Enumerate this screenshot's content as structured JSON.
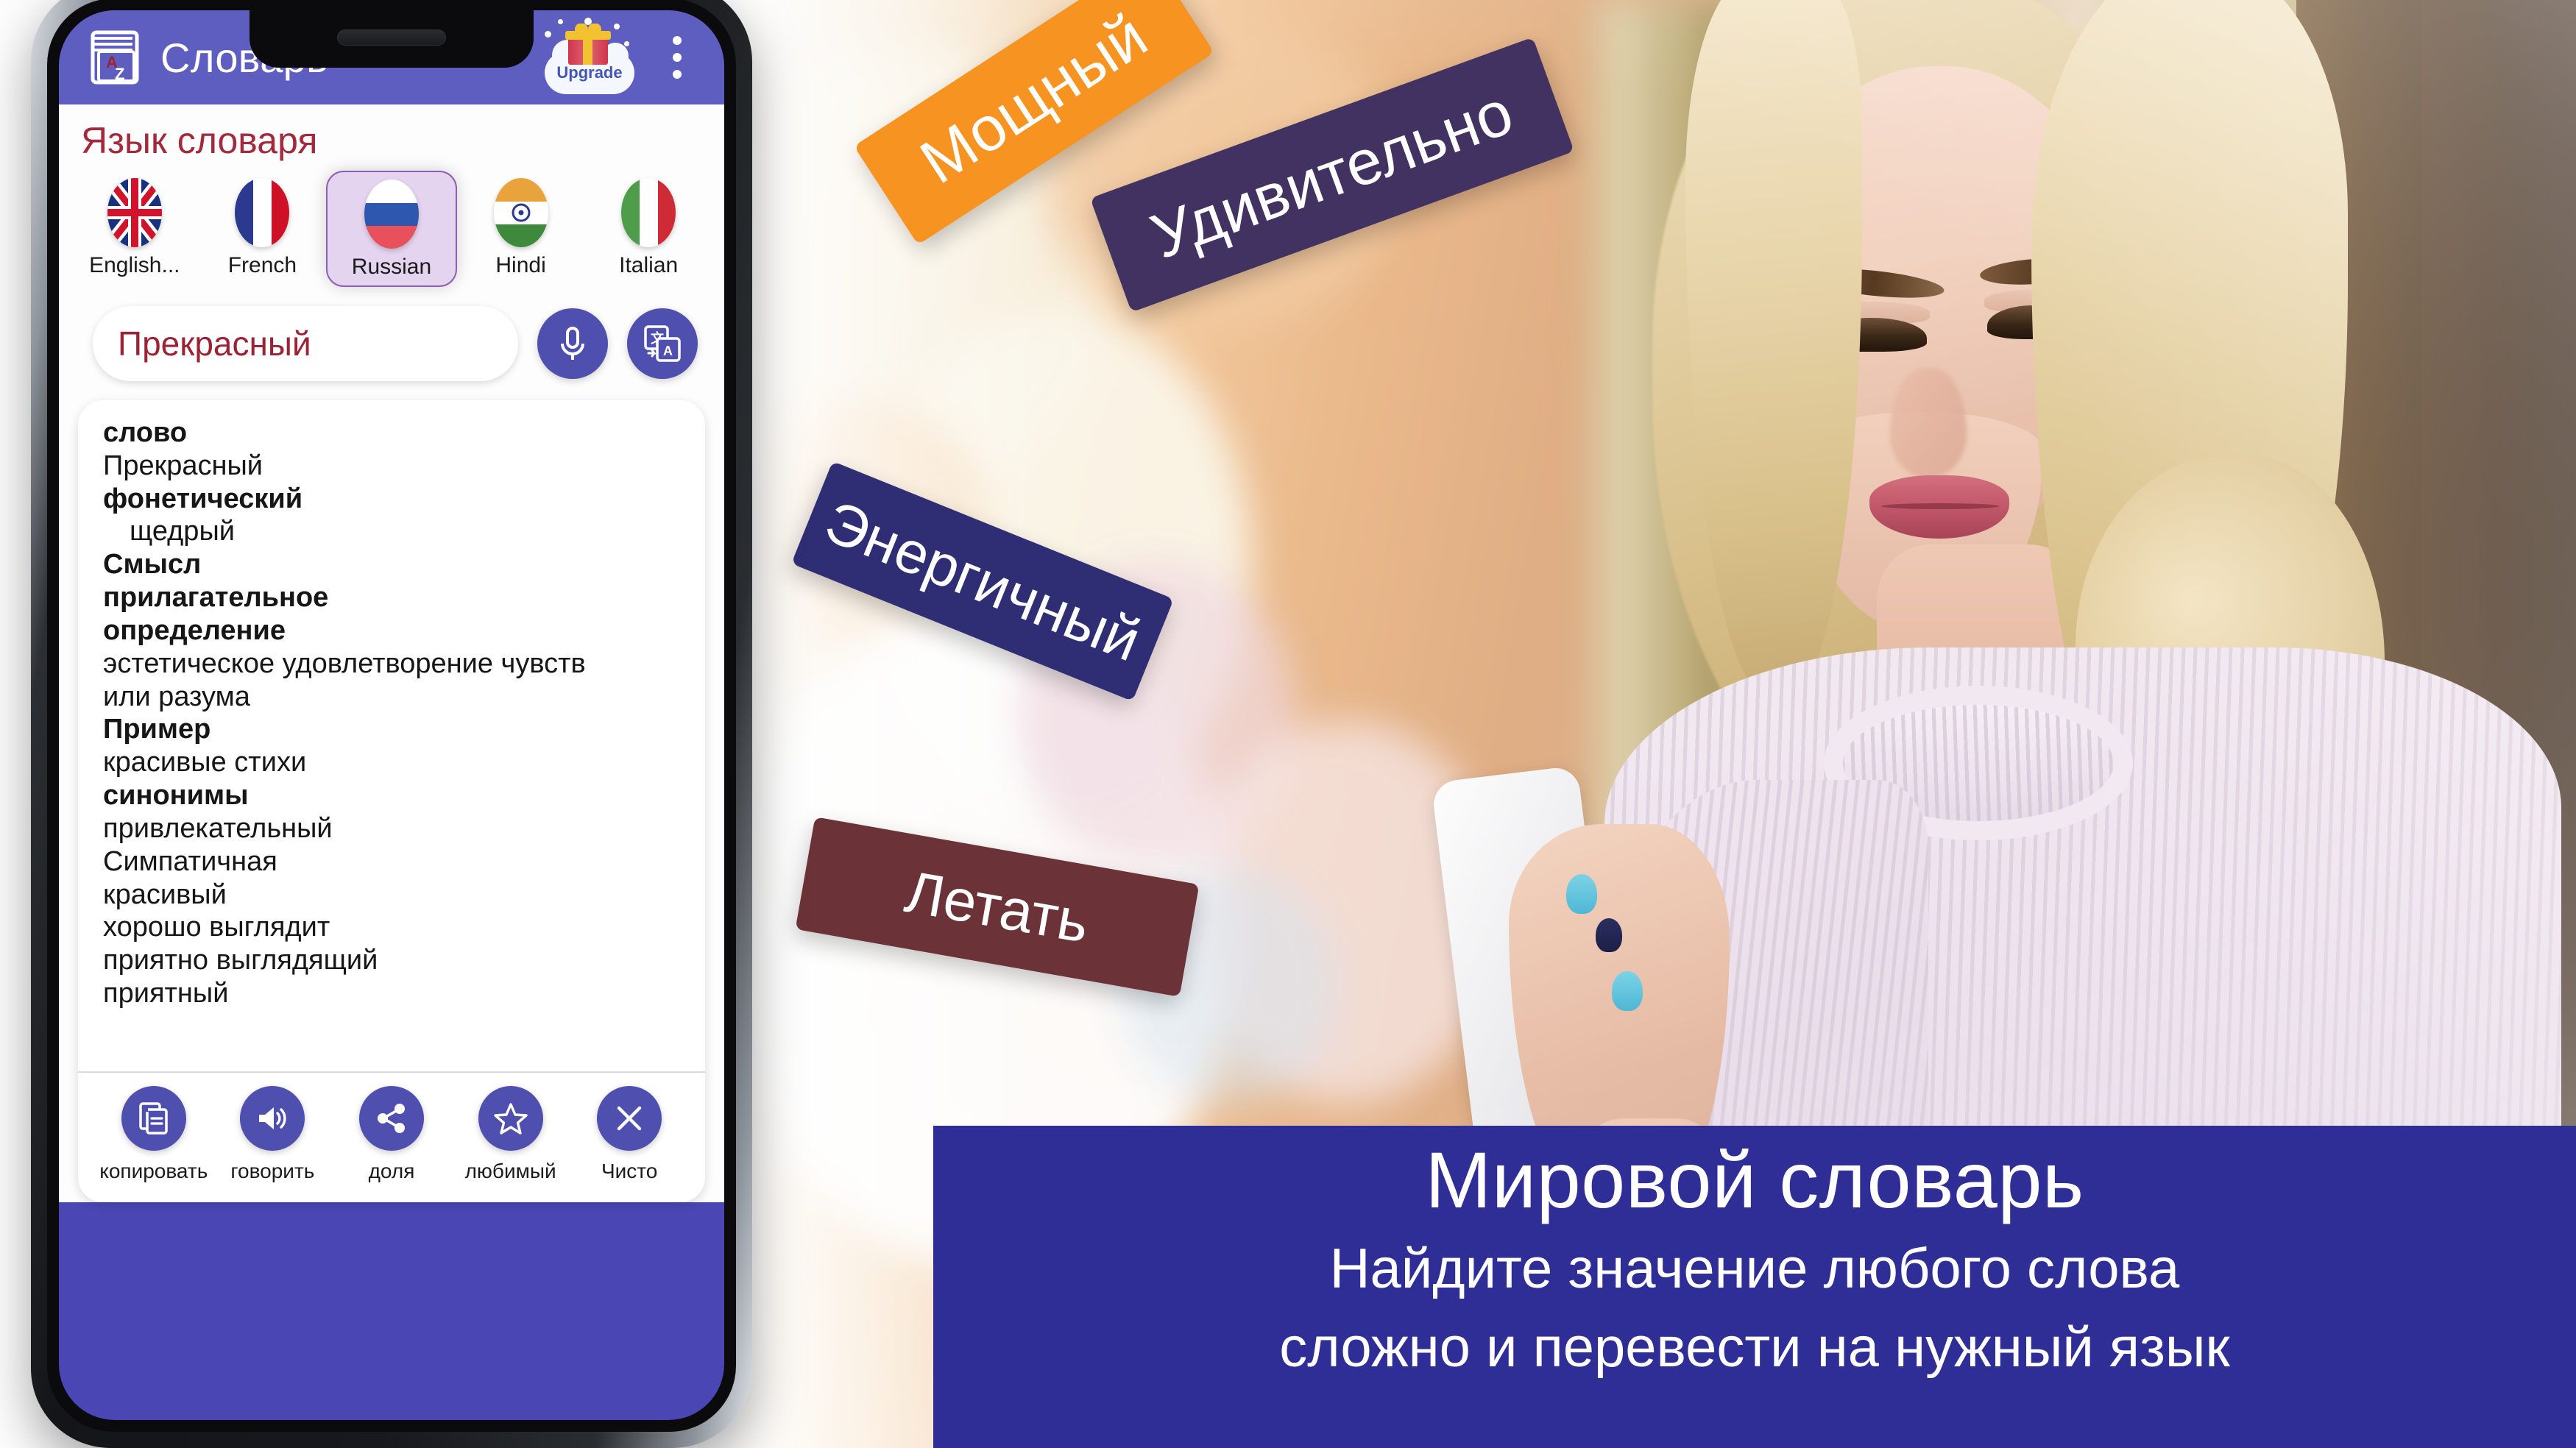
{
  "app": {
    "title": "Словарь",
    "book_icon": "dictionary-book-az-icon",
    "upgrade_label": "Upgrade",
    "upgrade_icon": "gift-box-icon",
    "overflow_icon": "kebab-menu-icon",
    "appbar_color": "#5E5EC0",
    "screen_bg_color": "#4A47B5"
  },
  "language_section": {
    "heading": "Язык словаря",
    "heading_color": "#A32A3C",
    "selected": "Russian",
    "languages": [
      {
        "label": "English...",
        "flag": "flag-united-kingdom",
        "selected": false
      },
      {
        "label": "French",
        "flag": "flag-france",
        "selected": false
      },
      {
        "label": "Russian",
        "flag": "flag-russia",
        "selected": true
      },
      {
        "label": "Hindi",
        "flag": "flag-india",
        "selected": false
      },
      {
        "label": "Italian",
        "flag": "flag-italy",
        "selected": false
      }
    ]
  },
  "search": {
    "value": "Прекрасный",
    "placeholder": "Прекрасный",
    "text_color": "#9B2335",
    "search_icon": "magnifier-icon",
    "mic_icon": "microphone-icon",
    "translate_icon": "translate-icon"
  },
  "result": {
    "lines": [
      {
        "text": "слово",
        "bold": true,
        "indent": false
      },
      {
        "text": "Прекрасный",
        "bold": false,
        "indent": false
      },
      {
        "text": "фонетический",
        "bold": true,
        "indent": false
      },
      {
        "text": "щедрый",
        "bold": false,
        "indent": true
      },
      {
        "text": "Смысл",
        "bold": true,
        "indent": false
      },
      {
        "text": "прилагательное",
        "bold": true,
        "indent": false
      },
      {
        "text": "определение",
        "bold": true,
        "indent": false
      },
      {
        "text": "эстетическое удовлетворение чувств",
        "bold": false,
        "indent": false
      },
      {
        "text": "или разума",
        "bold": false,
        "indent": false
      },
      {
        "text": "Пример",
        "bold": true,
        "indent": false
      },
      {
        "text": "красивые стихи",
        "bold": false,
        "indent": false
      },
      {
        "text": "синонимы",
        "bold": true,
        "indent": false
      },
      {
        "text": "привлекательный",
        "bold": false,
        "indent": false
      },
      {
        "text": "Симпатичная",
        "bold": false,
        "indent": false
      },
      {
        "text": "красивый",
        "bold": false,
        "indent": false
      },
      {
        "text": "хорошо выглядит",
        "bold": false,
        "indent": false
      },
      {
        "text": "приятно выглядящий",
        "bold": false,
        "indent": false
      },
      {
        "text": "приятный",
        "bold": false,
        "indent": false
      }
    ]
  },
  "actions": [
    {
      "label": "копировать",
      "icon": "copy-icon"
    },
    {
      "label": "говорить",
      "icon": "speaker-icon"
    },
    {
      "label": "доля",
      "icon": "share-icon"
    },
    {
      "label": "любимый",
      "icon": "star-icon"
    },
    {
      "label": "Чисто",
      "icon": "close-x-icon"
    }
  ],
  "tags": [
    {
      "text": "Мощный",
      "color": "#F79421"
    },
    {
      "text": "Удивительно",
      "color": "#413262"
    },
    {
      "text": "Энергичный",
      "color": "#2F2E75"
    },
    {
      "text": "Летать",
      "color": "#6B3238"
    }
  ],
  "banner": {
    "title": "Мировой словарь",
    "subtitle_line1": "Найдите значение любого слова",
    "subtitle_line2": "сложно и перевести на нужный язык",
    "background_color": "#2E2E96",
    "text_color": "#FFFFFF"
  }
}
